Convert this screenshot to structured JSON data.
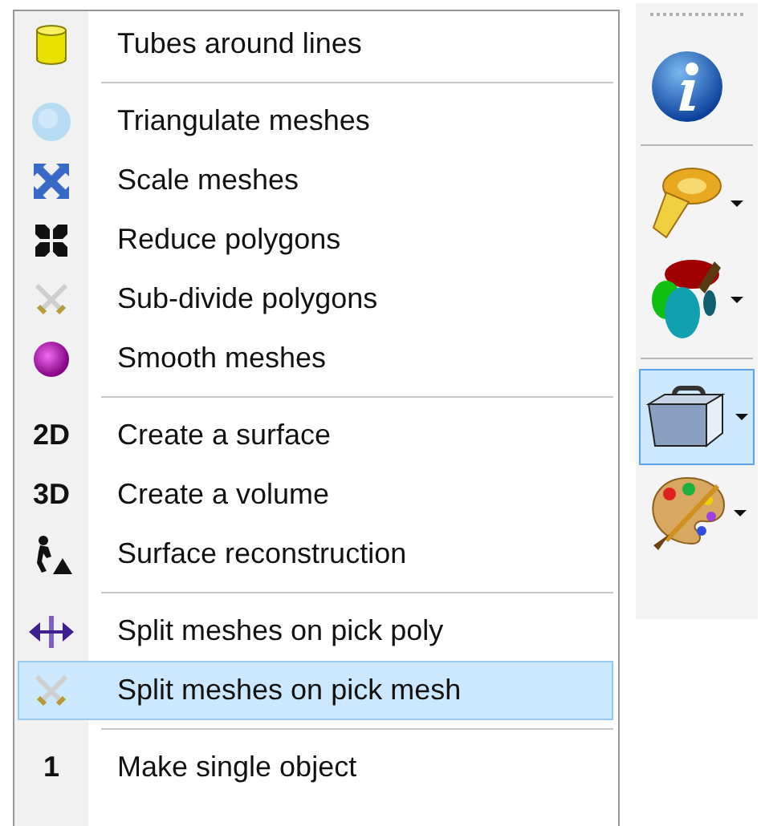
{
  "menu": {
    "items": [
      {
        "kind": "item",
        "label": "Tubes around lines",
        "selected": false
      },
      {
        "kind": "separator"
      },
      {
        "kind": "item",
        "label": "Triangulate meshes",
        "selected": false
      },
      {
        "kind": "item",
        "label": "Scale meshes",
        "selected": false
      },
      {
        "kind": "item",
        "label": "Reduce polygons",
        "selected": false
      },
      {
        "kind": "item",
        "label": "Sub-divide polygons",
        "selected": false
      },
      {
        "kind": "item",
        "label": "Smooth meshes",
        "selected": false
      },
      {
        "kind": "separator"
      },
      {
        "kind": "item",
        "label": "Create a surface",
        "badge": "2D",
        "selected": false
      },
      {
        "kind": "item",
        "label": "Create a volume",
        "badge": "3D",
        "selected": false
      },
      {
        "kind": "item",
        "label": "Surface reconstruction",
        "selected": false
      },
      {
        "kind": "separator"
      },
      {
        "kind": "item",
        "label": "Split meshes on pick poly",
        "selected": false
      },
      {
        "kind": "item",
        "label": "Split meshes on pick mesh",
        "selected": true
      },
      {
        "kind": "separator"
      },
      {
        "kind": "item",
        "label": "Make single object",
        "badge": "1",
        "selected": false
      }
    ]
  },
  "toolbar": {
    "buttons": [
      {
        "kind": "button",
        "dropdown": false,
        "selected": false
      },
      {
        "kind": "separator"
      },
      {
        "kind": "button",
        "dropdown": true,
        "selected": false
      },
      {
        "kind": "button",
        "dropdown": true,
        "selected": false
      },
      {
        "kind": "separator"
      },
      {
        "kind": "button",
        "dropdown": true,
        "selected": true
      },
      {
        "kind": "button",
        "dropdown": true,
        "selected": false
      }
    ]
  }
}
